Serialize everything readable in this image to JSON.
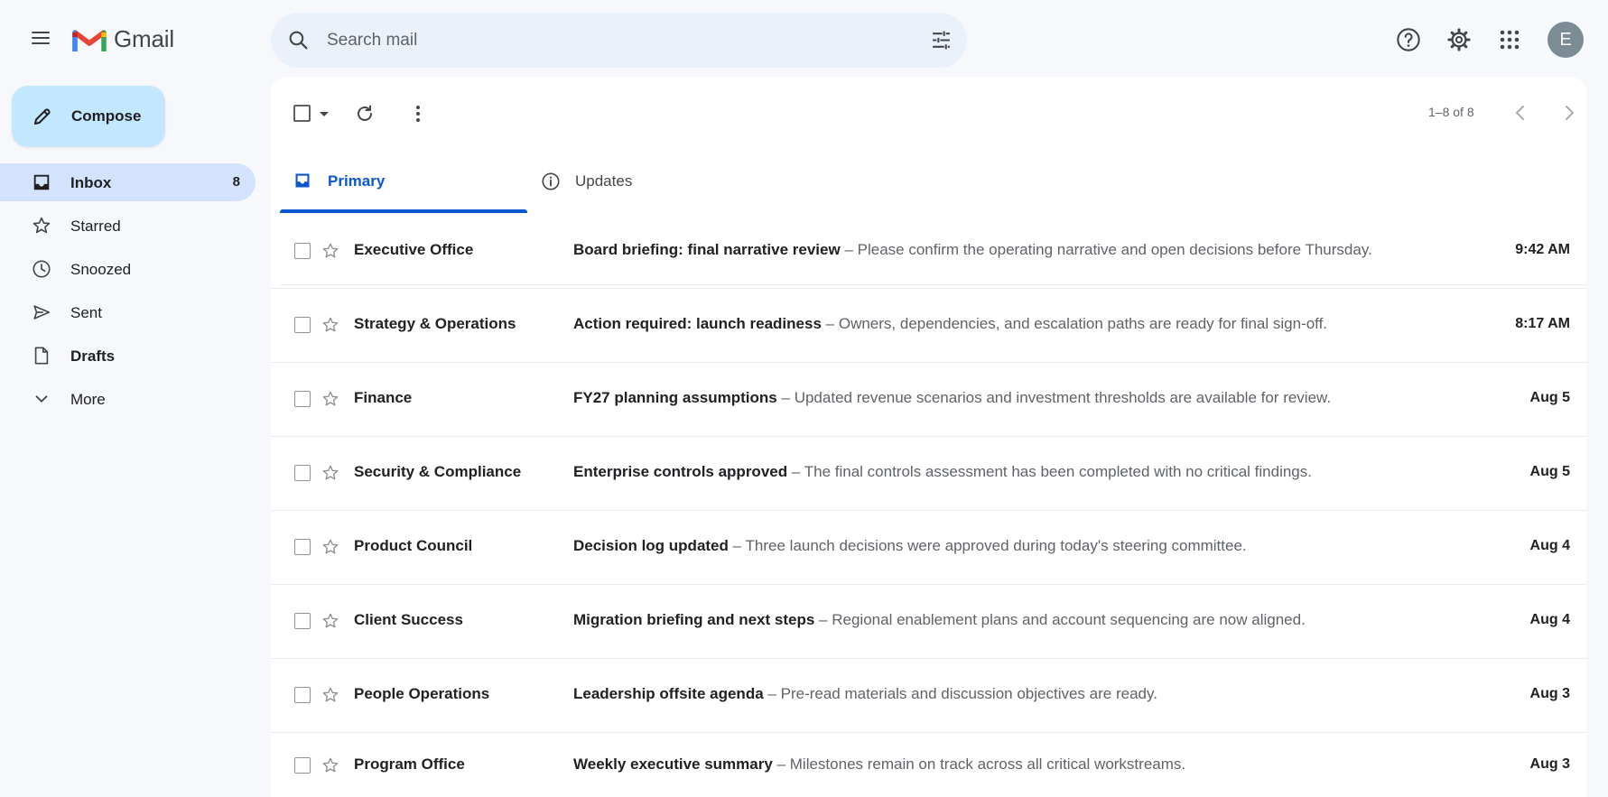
{
  "app": {
    "name": "Gmail"
  },
  "search": {
    "placeholder": "Search mail"
  },
  "header": {
    "avatar_letter": "E"
  },
  "colors": {
    "accent": "#0b57d0",
    "compose_bg": "#c2e7ff",
    "active_nav_bg": "#d3e3fd",
    "background": "#f6f8fc",
    "avatar_bg": "#7b8c95"
  },
  "sidebar": {
    "compose_label": "Compose",
    "items": [
      {
        "label": "Inbox",
        "count": "8",
        "icon": "inbox-icon",
        "active": true
      },
      {
        "label": "Starred",
        "count": "",
        "icon": "star-icon"
      },
      {
        "label": "Snoozed",
        "count": "",
        "icon": "clock-icon"
      },
      {
        "label": "Sent",
        "count": "",
        "icon": "send-icon"
      },
      {
        "label": "Drafts",
        "count": "",
        "icon": "draft-icon"
      },
      {
        "label": "More",
        "count": "",
        "icon": "chevron-down-icon"
      }
    ]
  },
  "toolbar": {
    "pager": "1–8 of 8"
  },
  "tabs": [
    {
      "label": "Primary",
      "icon": "inbox-icon",
      "active": true
    },
    {
      "label": "Updates",
      "icon": "info-icon",
      "active": false
    }
  ],
  "emails": [
    {
      "sender": "Executive Office",
      "subject": "Board briefing: final narrative review",
      "snippet": "Please confirm the operating narrative and open decisions before Thursday.",
      "time": "9:42 AM"
    },
    {
      "sender": "Strategy & Operations",
      "subject": "Action required: launch readiness",
      "snippet": "Owners, dependencies, and escalation paths are ready for final sign-off.",
      "time": "8:17 AM"
    },
    {
      "sender": "Finance",
      "subject": "FY27 planning assumptions",
      "snippet": "Updated revenue scenarios and investment thresholds are available for review.",
      "time": "Aug 5"
    },
    {
      "sender": "Security & Compliance",
      "subject": "Enterprise controls approved",
      "snippet": "The final controls assessment has been completed with no critical findings.",
      "time": "Aug 5"
    },
    {
      "sender": "Product Council",
      "subject": "Decision log updated",
      "snippet": "Three launch decisions were approved during today's steering committee.",
      "time": "Aug 4"
    },
    {
      "sender": "Client Success",
      "subject": "Migration briefing and next steps",
      "snippet": "Regional enablement plans and account sequencing are now aligned.",
      "time": "Aug 4"
    },
    {
      "sender": "People Operations",
      "subject": "Leadership offsite agenda",
      "snippet": "Pre-read materials and discussion objectives are ready.",
      "time": "Aug 3"
    },
    {
      "sender": "Program Office",
      "subject": "Weekly executive summary",
      "snippet": "Milestones remain on track across all critical workstreams.",
      "time": "Aug 3"
    }
  ],
  "separator": "–"
}
